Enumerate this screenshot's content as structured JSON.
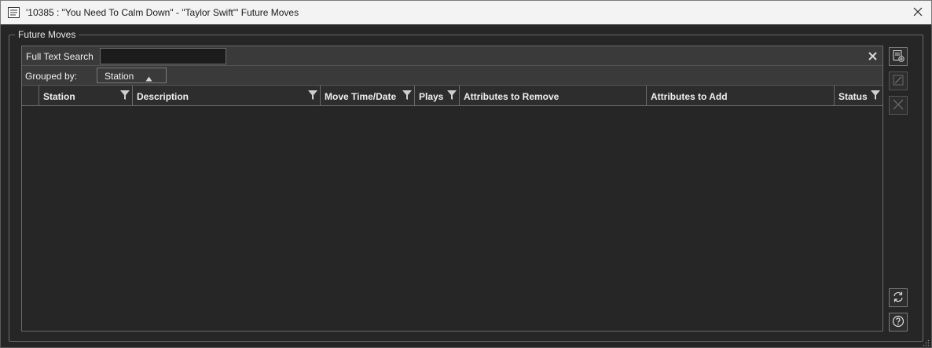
{
  "window": {
    "title": "'10385 : \"You Need To Calm Down\" - \"Taylor Swift\"' Future Moves",
    "title_icon": "document-list-icon",
    "close_icon": "close-icon"
  },
  "groupbox": {
    "legend": "Future Moves"
  },
  "search": {
    "label": "Full Text Search",
    "value": "",
    "placeholder": "",
    "clear_icon": "clear-icon"
  },
  "grouping": {
    "label": "Grouped by:",
    "chip_label": "Station",
    "chip_sort": "ascending"
  },
  "table": {
    "columns": [
      {
        "label": "Station",
        "filter": true
      },
      {
        "label": "Description",
        "filter": true
      },
      {
        "label": "Move Time/Date",
        "filter": true
      },
      {
        "label": "Plays",
        "filter": true
      },
      {
        "label": "Attributes to Remove",
        "filter": false
      },
      {
        "label": "Attributes to Add",
        "filter": false
      },
      {
        "label": "Status",
        "filter": true
      }
    ],
    "rows": []
  },
  "side_buttons": [
    {
      "name": "add-move-button",
      "icon": "add-document-icon",
      "enabled": true
    },
    {
      "name": "edit-move-button",
      "icon": "edit-icon",
      "enabled": false
    },
    {
      "name": "delete-move-button",
      "icon": "delete-icon",
      "enabled": false
    },
    {
      "name": "refresh-button",
      "icon": "refresh-icon",
      "enabled": true
    },
    {
      "name": "help-button",
      "icon": "help-icon",
      "enabled": true
    }
  ],
  "colors": {
    "background": "#262626",
    "header": "#3a3a3a",
    "border": "#6a6a6a",
    "titlebar": "#f3f3f3"
  }
}
